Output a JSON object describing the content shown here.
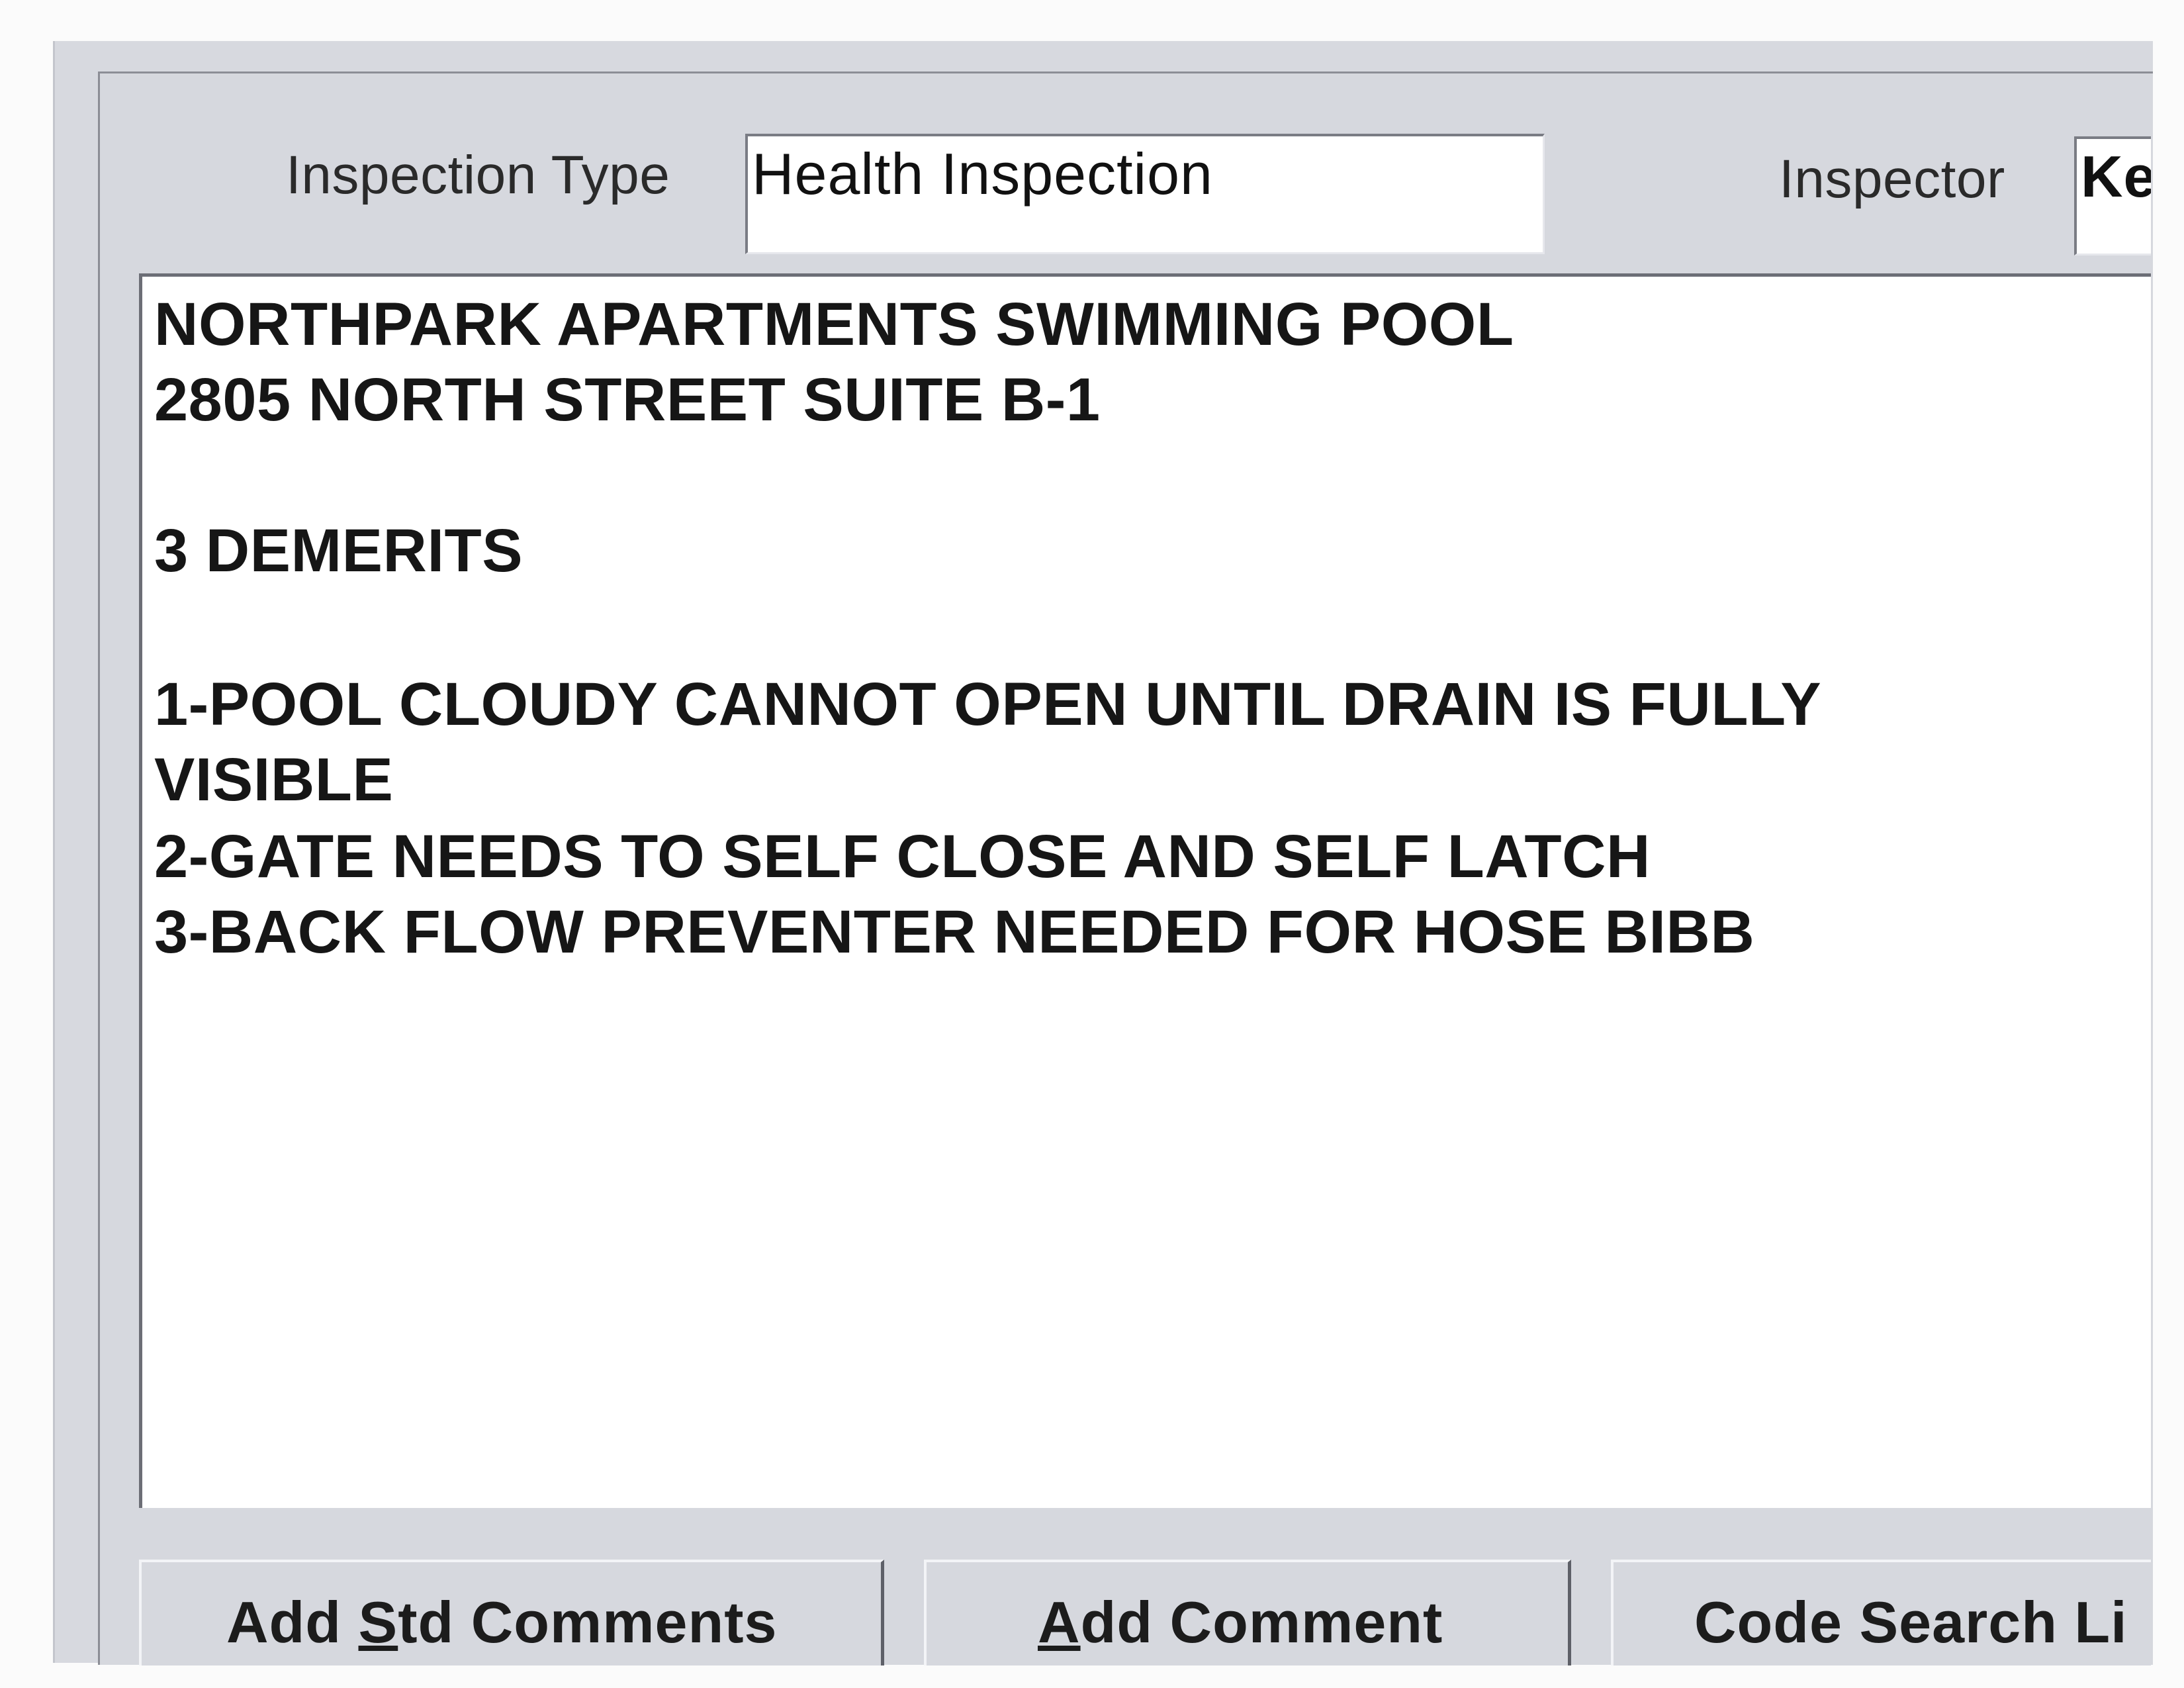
{
  "header": {
    "inspection_type_label": "Inspection Type",
    "inspection_type_value": "Health Inspection",
    "inspector_label": "Inspector",
    "inspector_value": "Ke"
  },
  "comments": {
    "lines": [
      "NORTHPARK APARTMENTS SWIMMING POOL",
      "2805 NORTH STREET SUITE B-1",
      "",
      "3 DEMERITS",
      "",
      "1-POOL CLOUDY CANNOT OPEN UNTIL DRAIN IS FULLY",
      "VISIBLE",
      "2-GATE NEEDS TO SELF CLOSE AND SELF LATCH",
      "3-BACK FLOW PREVENTER NEEDED FOR HOSE BIBB"
    ]
  },
  "buttons": {
    "add_std_comments": {
      "before": "Add ",
      "accel": "S",
      "after": "td Comments"
    },
    "add_comment": {
      "before": "",
      "accel": "A",
      "after": "dd Comment"
    },
    "code_search": {
      "label": "Code Search Li"
    }
  }
}
